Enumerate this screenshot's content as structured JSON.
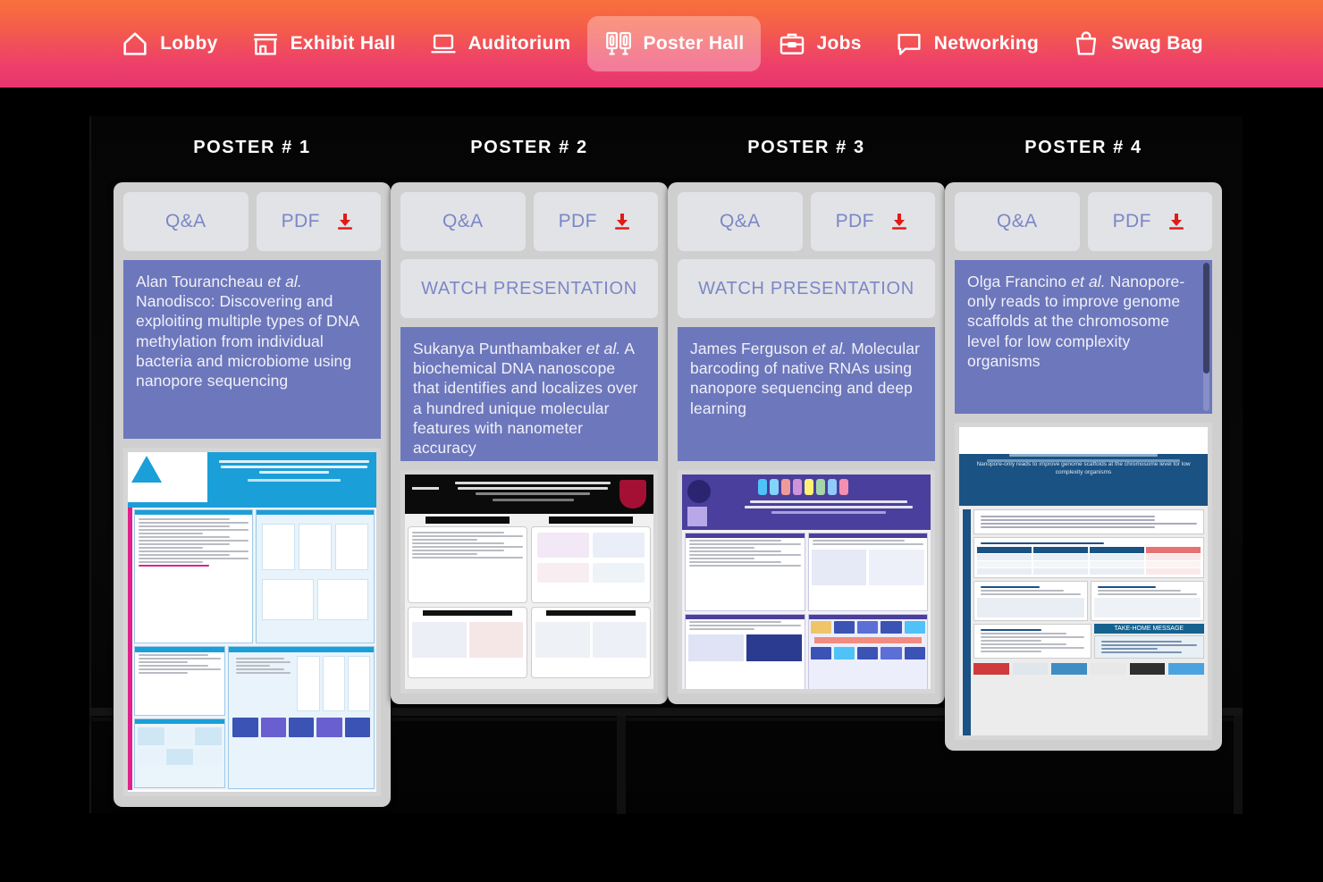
{
  "nav": {
    "items": [
      {
        "label": "Lobby",
        "icon": "home-icon",
        "active": false
      },
      {
        "label": "Exhibit Hall",
        "icon": "storefront-icon",
        "active": false
      },
      {
        "label": "Auditorium",
        "icon": "laptop-icon",
        "active": false
      },
      {
        "label": "Poster Hall",
        "icon": "poster-boards-icon",
        "active": true
      },
      {
        "label": "Jobs",
        "icon": "briefcase-icon",
        "active": false
      },
      {
        "label": "Networking",
        "icon": "chat-bubble-icon",
        "active": false
      },
      {
        "label": "Swag Bag",
        "icon": "shopping-bag-icon",
        "active": false
      }
    ]
  },
  "colors": {
    "nav_gradient_top": "#f9713c",
    "nav_gradient_bottom": "#e8356f",
    "active_tab_overlay": "rgba(255,255,255,0.32)",
    "card_bg": "#cfcfcf",
    "button_bg": "#e2e3e6",
    "button_text": "#7b87c7",
    "title_block_bg": "#6d77bc",
    "download_icon": "#e01b16",
    "stage_bg": "#000000"
  },
  "posters": [
    {
      "heading": "POSTER # 1",
      "qa_label": "Q&A",
      "pdf_label": "PDF",
      "download_icon": "download-icon",
      "has_watch": false,
      "watch_label": "",
      "author": "Alan Tourancheau",
      "et_al": "et al.",
      "title": "Nanodisco: Discovering and exploiting multiple types of DNA methylation from individual bacteria and microbiome using nanopore sequencing",
      "has_scrollbar": false,
      "thumbnail_alt": "poster-thumbnail-1"
    },
    {
      "heading": "POSTER # 2",
      "qa_label": "Q&A",
      "pdf_label": "PDF",
      "download_icon": "download-icon",
      "has_watch": true,
      "watch_label": "WATCH PRESENTATION",
      "author": "Sukanya Punthambaker",
      "et_al": "et al.",
      "title": "A biochemical DNA nanoscope that identifies and localizes over a hundred unique molecular features with nanometer accuracy",
      "has_scrollbar": false,
      "thumbnail_alt": "poster-thumbnail-2"
    },
    {
      "heading": "POSTER # 3",
      "qa_label": "Q&A",
      "pdf_label": "PDF",
      "download_icon": "download-icon",
      "has_watch": true,
      "watch_label": "WATCH PRESENTATION",
      "author": "James Ferguson",
      "et_al": "et al.",
      "title": "Molecular barcoding of native RNAs using nanopore sequencing and deep learning",
      "has_scrollbar": false,
      "thumbnail_alt": "poster-thumbnail-3"
    },
    {
      "heading": "POSTER # 4",
      "qa_label": "Q&A",
      "pdf_label": "PDF",
      "download_icon": "download-icon",
      "has_watch": false,
      "watch_label": "",
      "author": "Olga Francino",
      "et_al": "et al.",
      "title": "Nanopore-only reads to improve genome scaffolds at the chromosome level for low complexity organisms",
      "has_scrollbar": true,
      "thumbnail_alt": "poster-thumbnail-4",
      "thumbnail_banner": "Nanopore-only reads to improve genome scaffolds at the chromosome level for low complexity organisms",
      "thumbnail_take_home": "TAKE-HOME MESSAGE"
    }
  ]
}
